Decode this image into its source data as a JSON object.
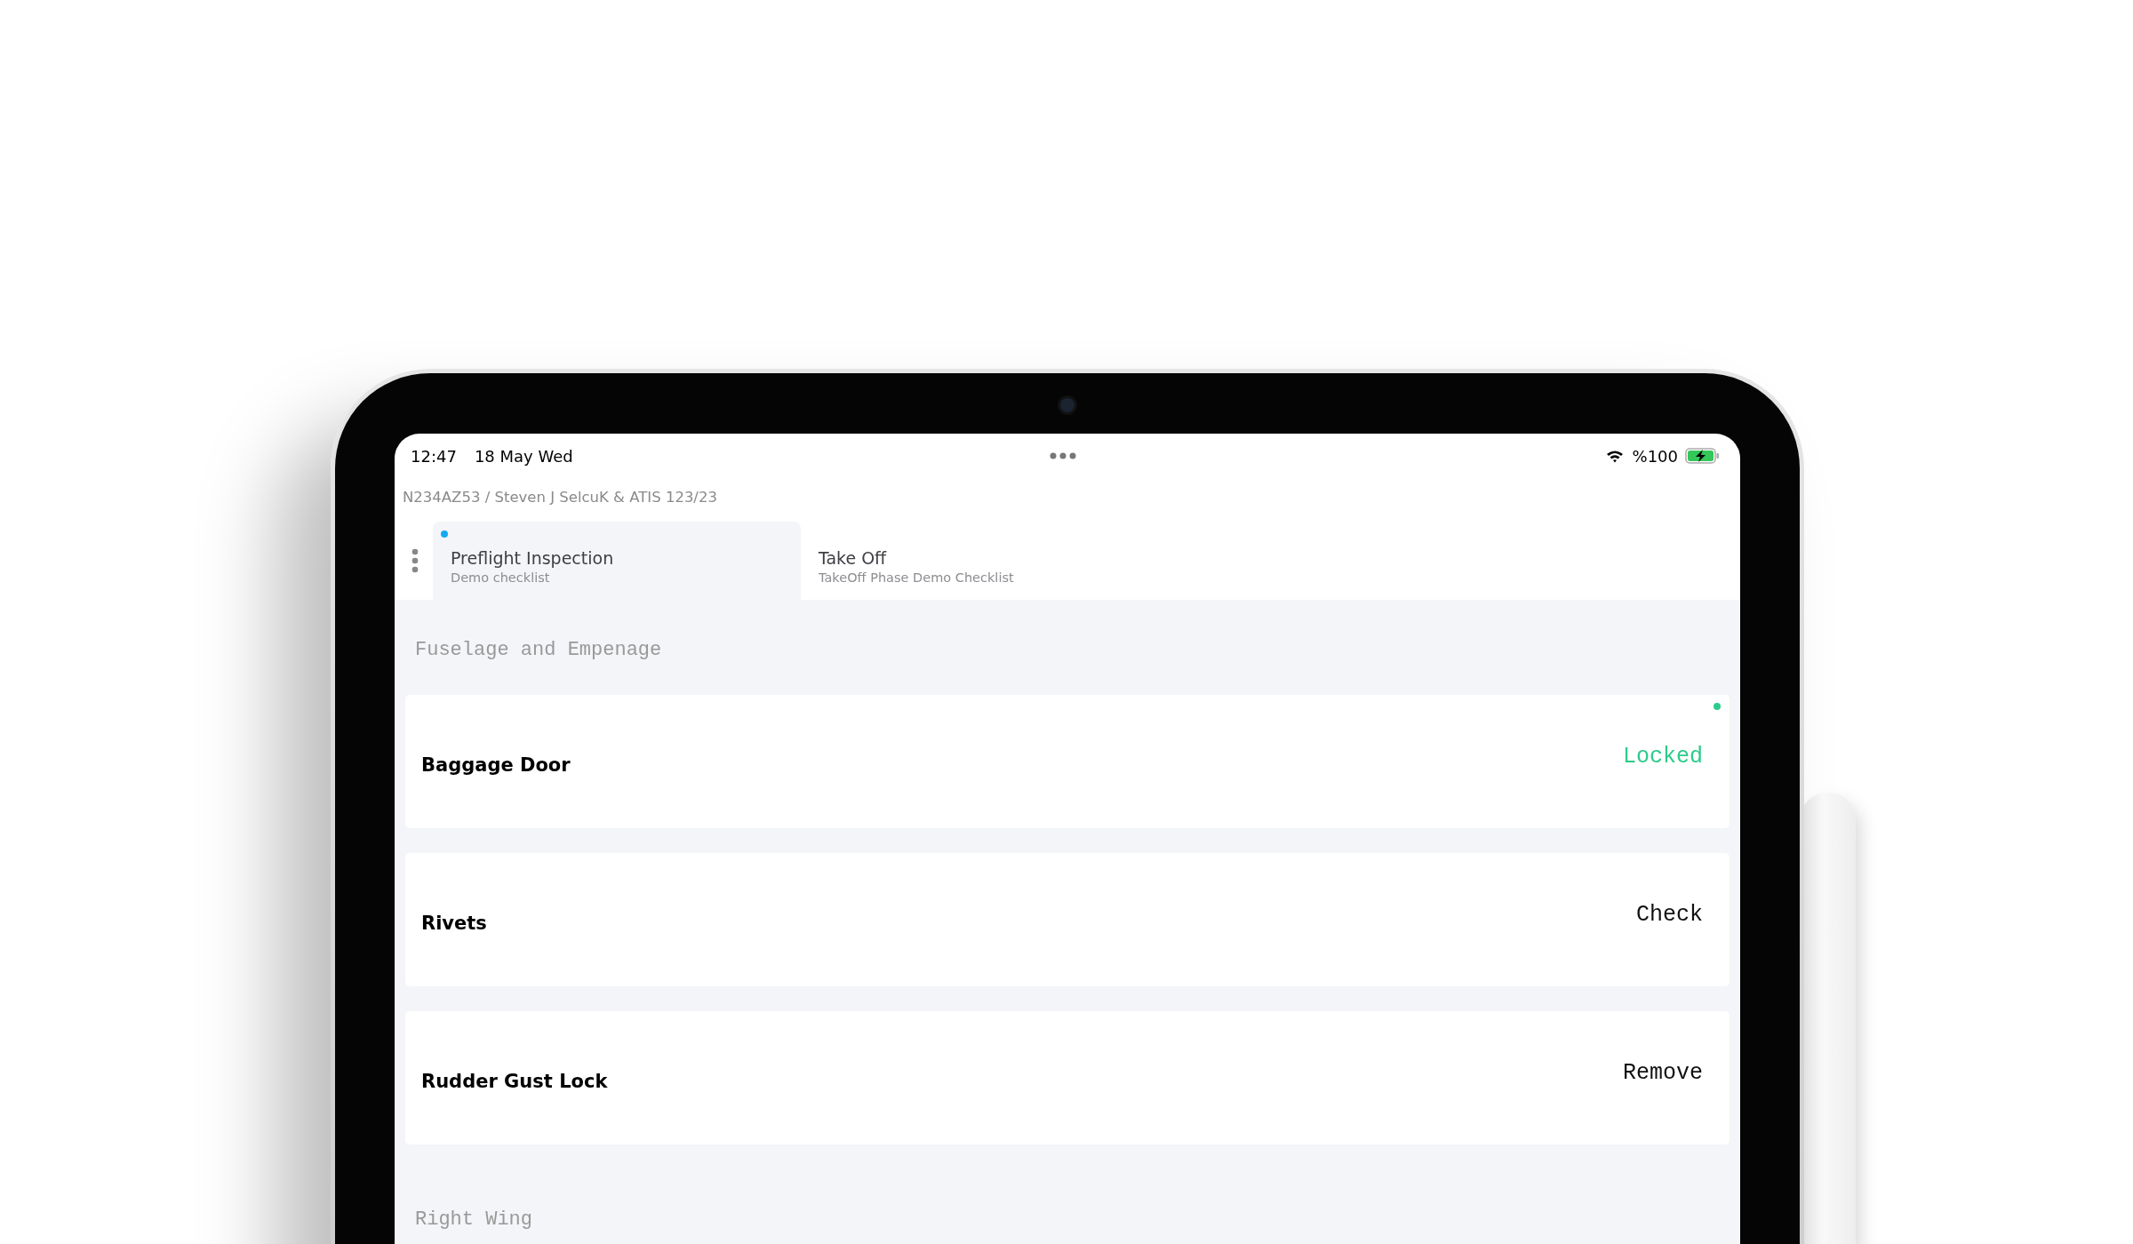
{
  "status_bar": {
    "time": "12:47",
    "date": "18 May Wed",
    "battery": "%100",
    "charging": true
  },
  "breadcrumb": "N234AZ53 / Steven J SelcuK & ATIS 123/23",
  "tabs": [
    {
      "title": "Preflight Inspection",
      "subtitle": "Demo checklist",
      "selected": true
    },
    {
      "title": "Take Off",
      "subtitle": "TakeOff Phase Demo Checklist",
      "selected": false
    }
  ],
  "sections": [
    {
      "title": "Fuselage and Empenage",
      "items": [
        {
          "label": "Baggage Door",
          "value": "Locked",
          "done": true
        },
        {
          "label": "Rivets",
          "value": "Check",
          "done": false
        },
        {
          "label": "Rudder Gust Lock",
          "value": "Remove",
          "done": false
        }
      ]
    },
    {
      "title": "Right Wing"
    }
  ]
}
